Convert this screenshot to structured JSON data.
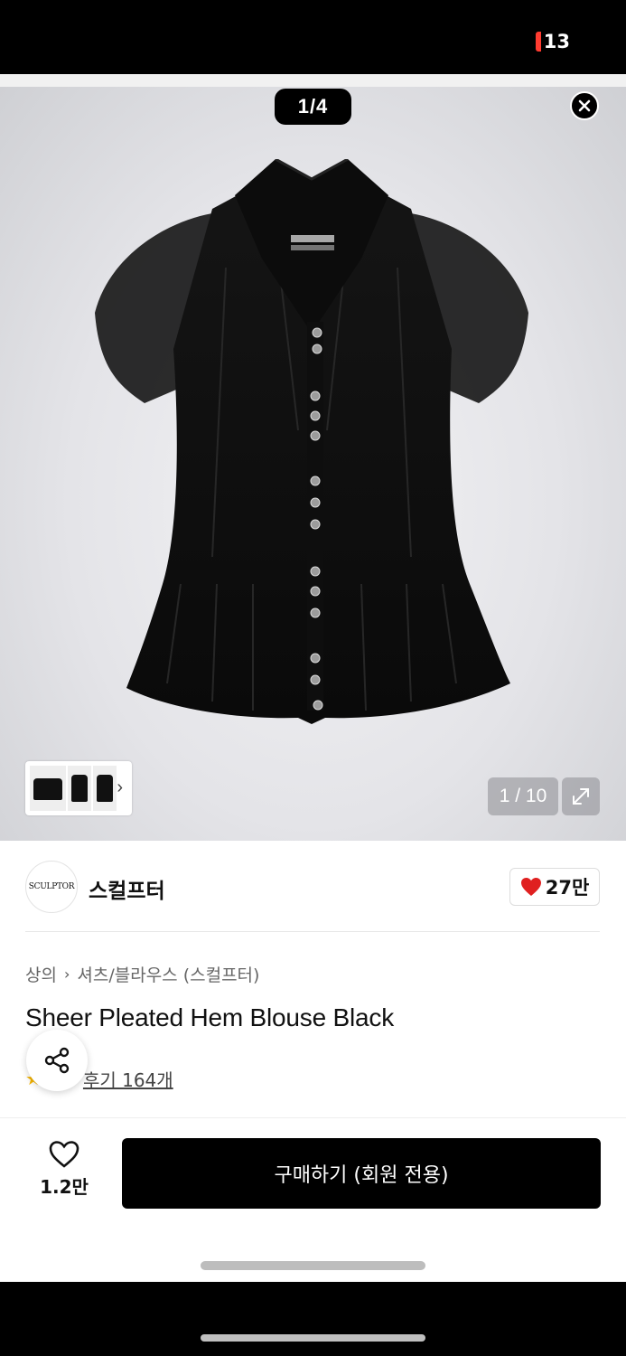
{
  "status_bar": {
    "battery_level": "13",
    "battery_color": "#ff3b30"
  },
  "gallery": {
    "page_indicator": "1/4",
    "image_counter": "1 / 10",
    "thumbnails": 3,
    "icons": {
      "close": "close-icon",
      "expand": "expand-icon",
      "next": "chevron-right-icon"
    }
  },
  "brand": {
    "logo_text": "SCULPTOR",
    "name": "스컬프터",
    "like_count": "27만",
    "heart_color": "#e02020"
  },
  "breadcrumb": {
    "category": "상의",
    "subcategory": "셔츠/블라우스 (스컬프터)"
  },
  "product": {
    "title": "Sheer Pleated Hem Blouse Black",
    "review_link": "후기 164개"
  },
  "bottom_bar": {
    "wish_count": "1.2만",
    "buy_label": "구매하기 (회원 전용)"
  }
}
